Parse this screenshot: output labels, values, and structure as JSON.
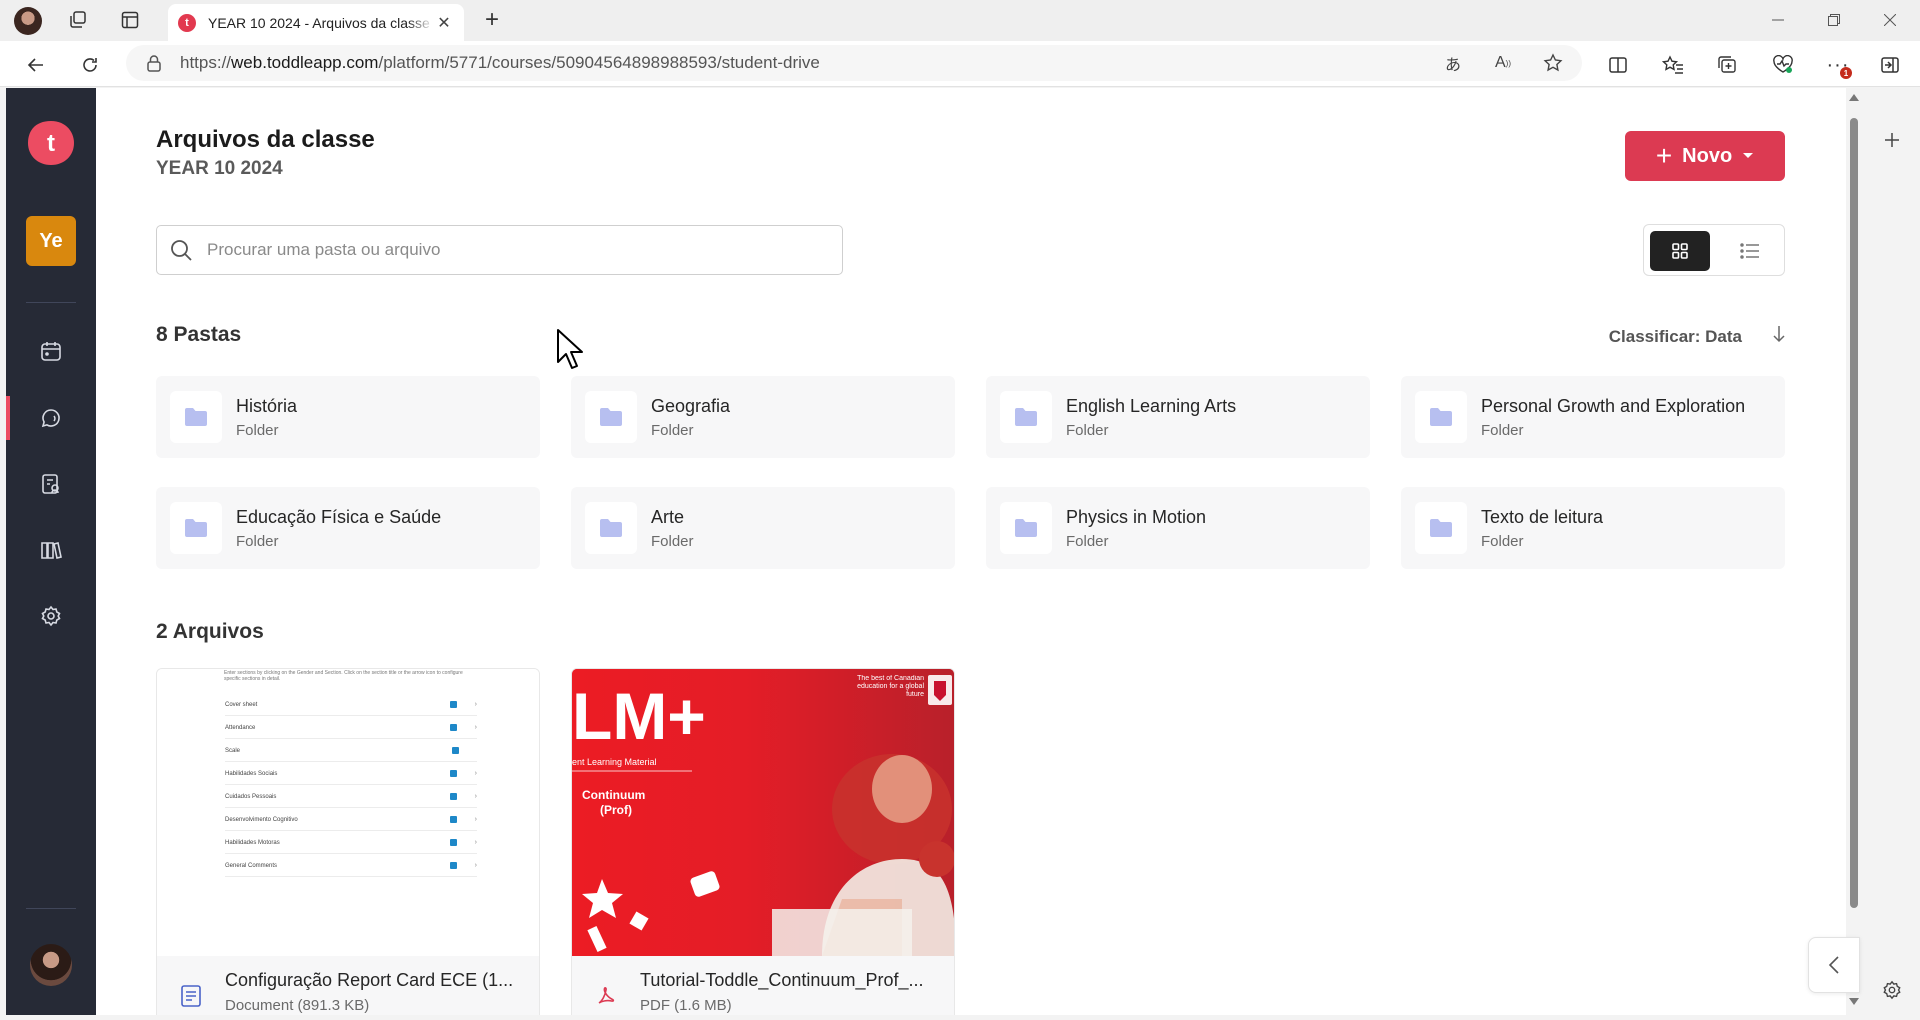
{
  "browser": {
    "tab_title": "YEAR 10 2024 - Arquivos da classe",
    "url_prefix": "https://",
    "url_host": "web.toddleapp.com",
    "url_path": "/platform/5771/courses/50904564898988593/student-drive",
    "extension_badge": "1"
  },
  "app": {
    "logo_letter": "t",
    "class_badge": "Ye",
    "nav_items": [
      "calendar-icon",
      "chat-icon",
      "gradebook-icon",
      "library-icon",
      "settings-icon"
    ]
  },
  "header": {
    "title": "Arquivos da classe",
    "subtitle": "YEAR 10 2024",
    "new_button": "Novo"
  },
  "search": {
    "placeholder": "Procurar uma pasta ou arquivo",
    "value": ""
  },
  "folders_section": {
    "title": "8 Pastas",
    "sort_label": "Classificar: Data",
    "items": [
      {
        "name": "História",
        "type": "Folder"
      },
      {
        "name": "Geografia",
        "type": "Folder"
      },
      {
        "name": "English Learning Arts",
        "type": "Folder"
      },
      {
        "name": "Personal Growth and Exploration",
        "type": "Folder"
      },
      {
        "name": "Educação Física e Saúde",
        "type": "Folder"
      },
      {
        "name": "Arte",
        "type": "Folder"
      },
      {
        "name": "Physics in Motion",
        "type": "Folder"
      },
      {
        "name": "Texto de leitura",
        "type": "Folder"
      }
    ]
  },
  "files_section": {
    "title": "2 Arquivos",
    "items": [
      {
        "name": "Configuração Report Card ECE (1...",
        "meta": "Document (891.3 KB)"
      },
      {
        "name": "Tutorial-Toddle_Continuum_Prof_...",
        "meta": "PDF (1.6 MB)"
      }
    ]
  },
  "doc_thumb": {
    "intro": "Enter sections by clicking on the Gender and Section. Click on the section title or the arrow icon to configure specific sections in detail.",
    "rows": [
      "Cover sheet",
      "Attendance",
      "Scale",
      "Habilidades Sociais",
      "Cuidados Pessoais",
      "Desenvolvimento Cognitivo",
      "Habilidades Motoras",
      "General Comments"
    ]
  },
  "pdf_thumb": {
    "brand": "LM+",
    "brand_sub": "ent Learning Material",
    "tagline": "The best of Canadian education for a global future",
    "label_line1": "Continuum",
    "label_line2": "(Prof)"
  },
  "colors": {
    "accent": "#dc3a52",
    "nav_bg": "#262a36",
    "class_badge": "#d9880e",
    "folder_icon": "#b7bff0"
  }
}
